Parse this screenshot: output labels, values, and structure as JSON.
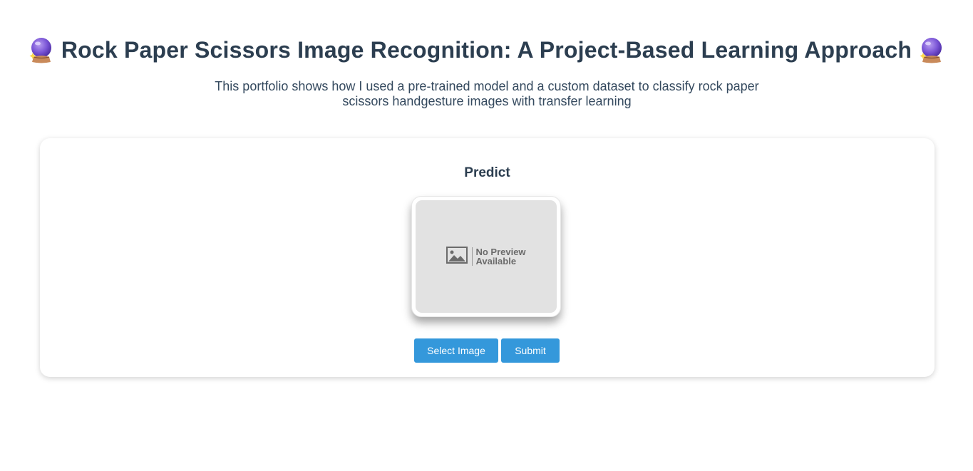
{
  "header": {
    "title": "Rock Paper Scissors Image Recognition: A Project-Based Learning Approach",
    "left_icon": "crystal-ball-icon",
    "right_icon": "crystal-ball-icon"
  },
  "subtitle": "This portfolio shows how I used a pre-trained model and a custom dataset to classify rock paper scissors handgesture images with transfer learning",
  "card": {
    "title": "Predict",
    "preview": {
      "icon": "image-placeholder-icon",
      "text_line1": "No Preview",
      "text_line2": "Available"
    },
    "buttons": {
      "select_label": "Select Image",
      "submit_label": "Submit"
    }
  },
  "colors": {
    "heading": "#2c3e50",
    "accent": "#3498db",
    "preview_bg": "#e2e2e2"
  }
}
